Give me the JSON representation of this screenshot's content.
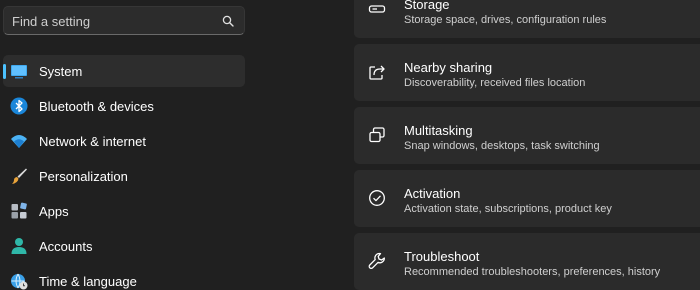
{
  "search": {
    "placeholder": "Find a setting",
    "icon": "search-icon"
  },
  "sidebar": {
    "accent_color": "#4cc2ff",
    "items": [
      {
        "label": "System",
        "icon": "monitor-icon",
        "selected": true
      },
      {
        "label": "Bluetooth & devices",
        "icon": "bluetooth-icon"
      },
      {
        "label": "Network & internet",
        "icon": "wifi-icon"
      },
      {
        "label": "Personalization",
        "icon": "paintbrush-icon"
      },
      {
        "label": "Apps",
        "icon": "apps-icon"
      },
      {
        "label": "Accounts",
        "icon": "person-icon"
      },
      {
        "label": "Time & language",
        "icon": "globe-clock-icon"
      }
    ]
  },
  "main": {
    "cards": [
      {
        "title": "Storage",
        "description": "Storage space, drives, configuration rules",
        "icon": "storage-icon"
      },
      {
        "title": "Nearby sharing",
        "description": "Discoverability, received files location",
        "icon": "share-icon"
      },
      {
        "title": "Multitasking",
        "description": "Snap windows, desktops, task switching",
        "icon": "multitasking-icon"
      },
      {
        "title": "Activation",
        "description": "Activation state, subscriptions, product key",
        "icon": "checkmark-circle-icon"
      },
      {
        "title": "Troubleshoot",
        "description": "Recommended troubleshooters, preferences, history",
        "icon": "wrench-icon"
      }
    ]
  }
}
